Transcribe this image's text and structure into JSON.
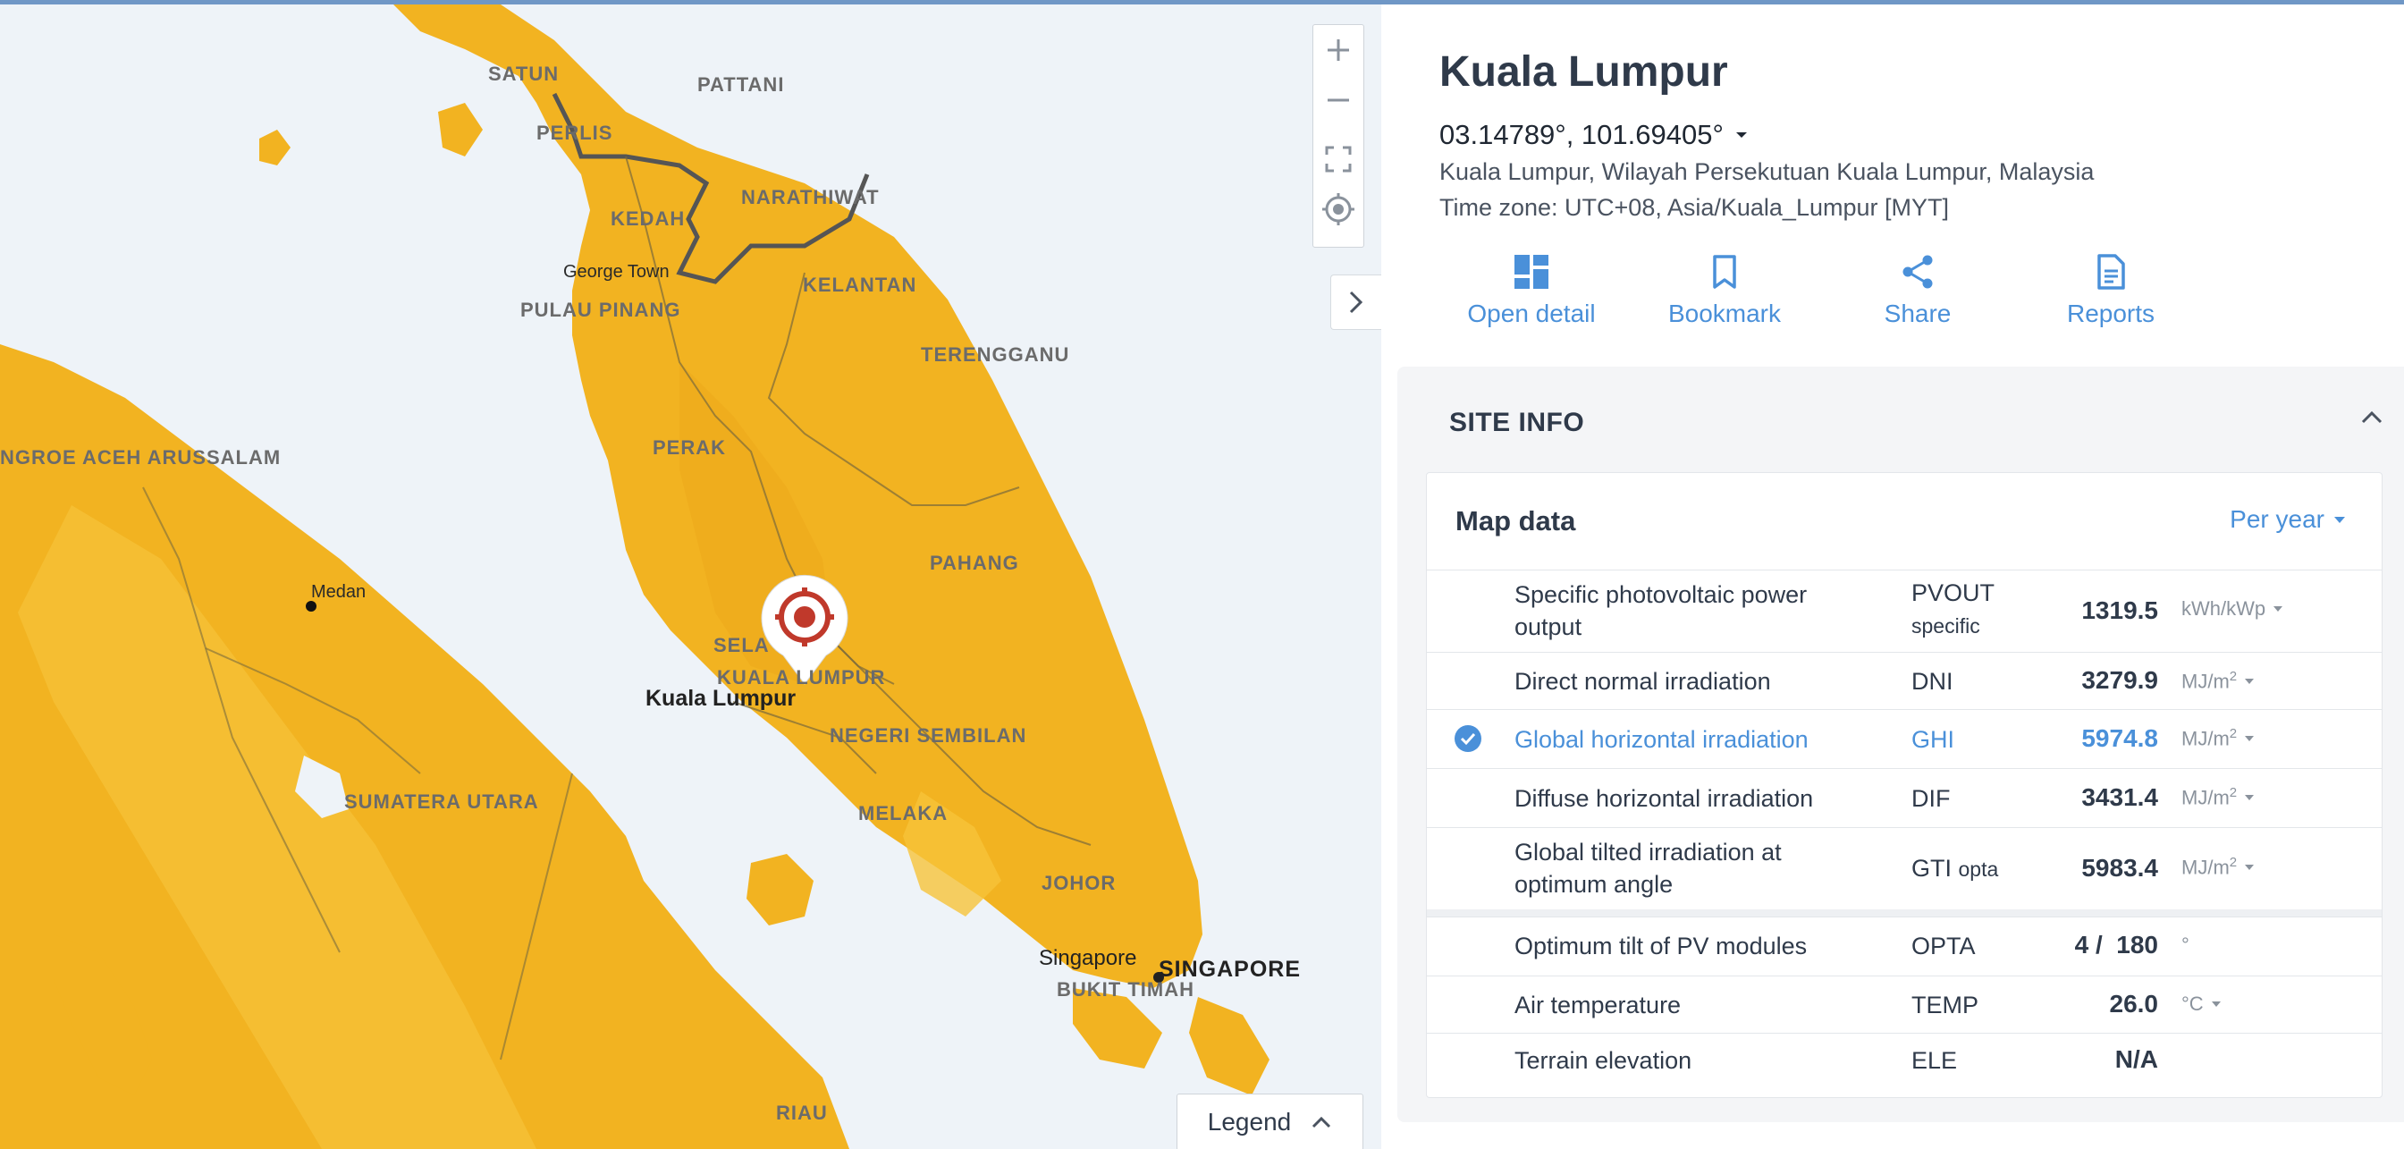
{
  "map": {
    "labels": {
      "satun": "SATUN",
      "pattani": "PATTANI",
      "perlis": "PERLIS",
      "kedah": "KEDAH",
      "narathiwat": "NARATHIWAT",
      "george_town": "George Town",
      "pulau_pinang": "PULAU PINANG",
      "kelantan": "KELANTAN",
      "terengganu": "TERENGGANU",
      "aceh": "NGROE ACEH ARUSSALAM",
      "perak": "PERAK",
      "pahang": "PAHANG",
      "medan": "Medan",
      "selangor": "SELA",
      "kl_region": "KUALA LUMPUR",
      "kl_city": "Kuala Lumpur",
      "negeri": "NEGERI SEMBILAN",
      "sumatera": "SUMATERA UTARA",
      "melaka": "MELAKA",
      "johor": "JOHOR",
      "singapore_city": "Singapore",
      "singapore_region": "SINGAPORE",
      "bukit_timah": "BUKIT TIMAH",
      "riau": "RIAU"
    },
    "legend_label": "Legend"
  },
  "location": {
    "title": "Kuala Lumpur",
    "coordinates": "03.14789°, 101.69405°",
    "address": "Kuala Lumpur, Wilayah Persekutuan Kuala Lumpur, Malaysia",
    "timezone": "Time zone: UTC+08, Asia/Kuala_Lumpur [MYT]"
  },
  "actions": [
    {
      "label": "Open detail",
      "icon": "dashboard-icon"
    },
    {
      "label": "Bookmark",
      "icon": "bookmark-icon"
    },
    {
      "label": "Share",
      "icon": "share-icon"
    },
    {
      "label": "Reports",
      "icon": "document-icon"
    }
  ],
  "site_info": {
    "title": "SITE INFO",
    "map_data_title": "Map data",
    "period": "Per year",
    "rows": [
      {
        "name_line1": "Specific photovoltaic power",
        "name_line2": "output",
        "abbr": "PVOUT",
        "abbr_sub": "specific",
        "value": "1319.5",
        "unit": "kWh/kWp",
        "selected": false
      },
      {
        "name_line1": "Direct normal irradiation",
        "abbr": "DNI",
        "value": "3279.9",
        "unit": "MJ/m",
        "unit_sup": "2",
        "selected": false
      },
      {
        "name_line1": "Global horizontal irradiation",
        "abbr": "GHI",
        "value": "5974.8",
        "unit": "MJ/m",
        "unit_sup": "2",
        "selected": true
      },
      {
        "name_line1": "Diffuse horizontal irradiation",
        "abbr": "DIF",
        "value": "3431.4",
        "unit": "MJ/m",
        "unit_sup": "2",
        "selected": false
      },
      {
        "name_line1": "Global tilted irradiation at",
        "name_line2": "optimum angle",
        "abbr": "GTI",
        "abbr_sub": "opta",
        "value": "5983.4",
        "unit": "MJ/m",
        "unit_sup": "2",
        "selected": false
      },
      {
        "name_line1": "Optimum tilt of PV modules",
        "abbr": "OPTA",
        "value": "4 /  180",
        "unit": "°",
        "selected": false
      },
      {
        "name_line1": "Air temperature",
        "abbr": "TEMP",
        "value": "26.0",
        "unit": "°C",
        "selected": false
      },
      {
        "name_line1": "Terrain elevation",
        "abbr": "ELE",
        "value": "N/A",
        "unit": "",
        "selected": false
      }
    ]
  },
  "colors": {
    "accent": "#4a90d9",
    "map_land": "#f0b41e",
    "map_sea": "#eef3f8",
    "marker": "#c0392b"
  }
}
